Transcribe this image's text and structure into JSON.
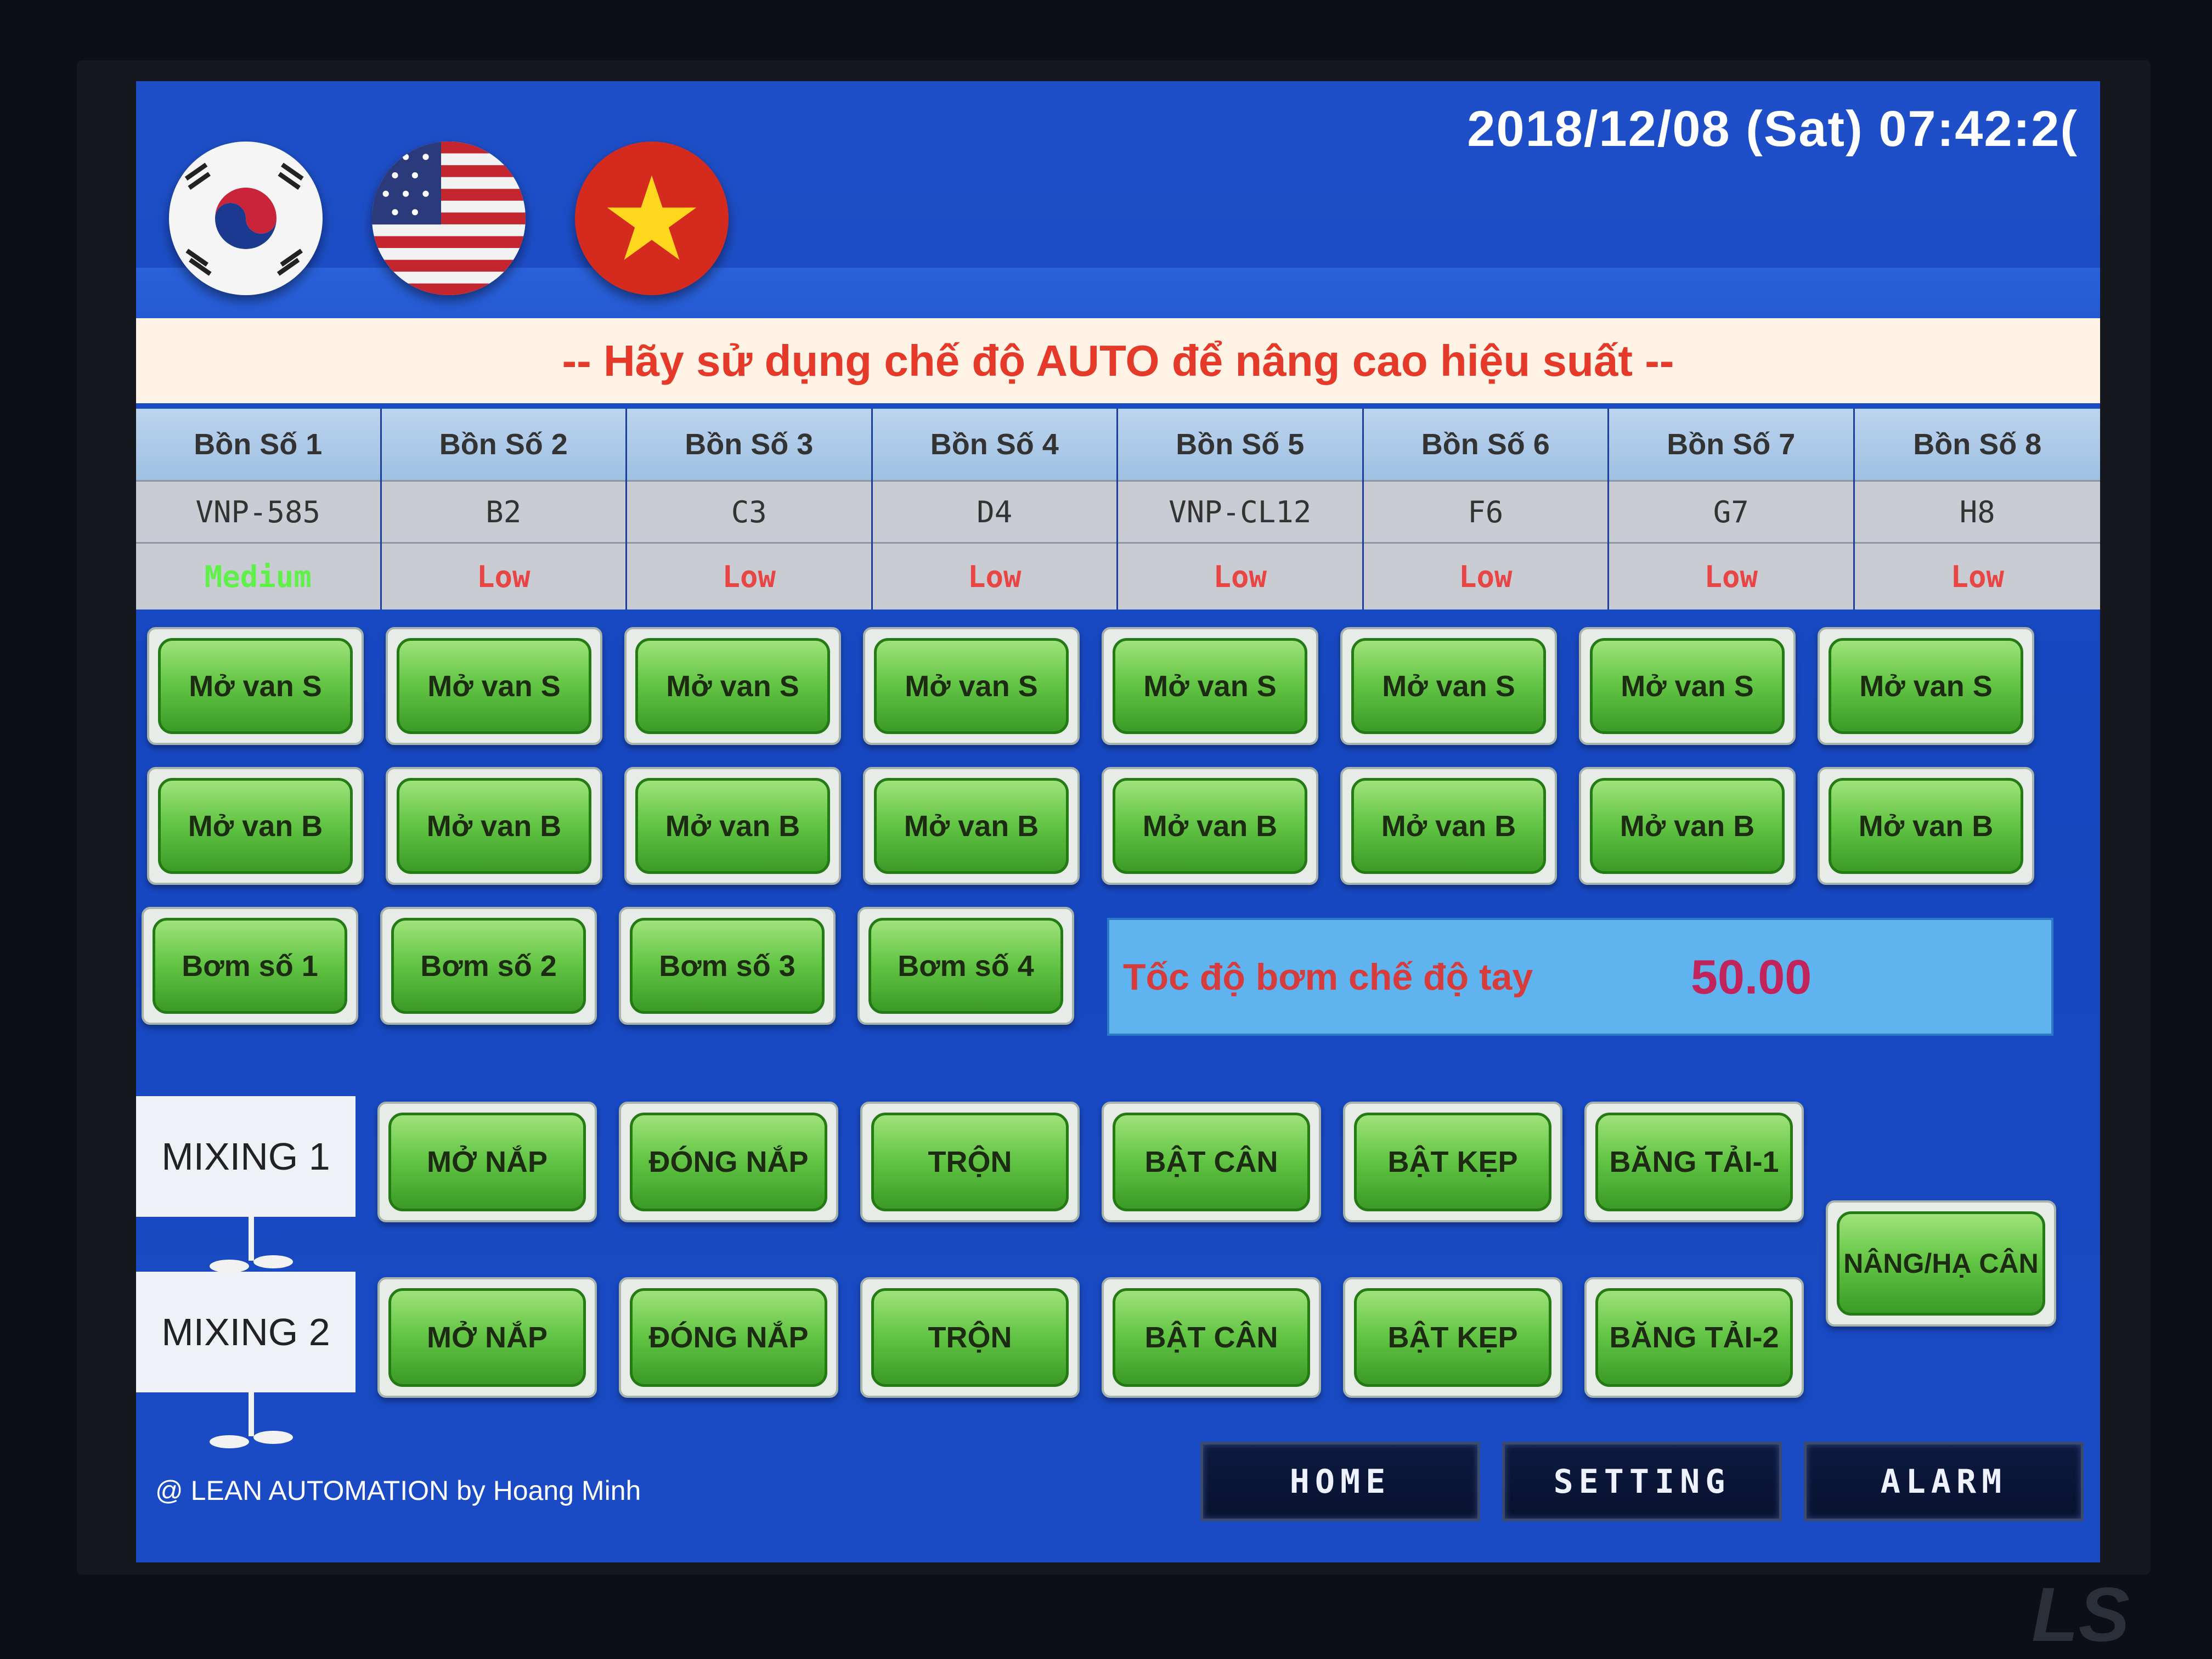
{
  "header": {
    "flags": [
      "korea-flag",
      "usa-flag",
      "vietnam-flag"
    ],
    "datetime": "2018/12/08 (Sat) 07:42:2("
  },
  "banner": {
    "text": "--  Hãy sử dụng chế độ AUTO để nâng cao hiệu suất  --"
  },
  "tanks": [
    {
      "name": "Bồn Số 1",
      "code": "VNP-585",
      "level": "Medium",
      "level_color": "#5ff04a"
    },
    {
      "name": "Bồn Số 2",
      "code": "B2",
      "level": "Low",
      "level_color": "#e84545"
    },
    {
      "name": "Bồn Số 3",
      "code": "C3",
      "level": "Low",
      "level_color": "#e84545"
    },
    {
      "name": "Bồn Số 4",
      "code": "D4",
      "level": "Low",
      "level_color": "#e84545"
    },
    {
      "name": "Bồn Số 5",
      "code": "VNP-CL12",
      "level": "Low",
      "level_color": "#e84545"
    },
    {
      "name": "Bồn Số 6",
      "code": "F6",
      "level": "Low",
      "level_color": "#e84545"
    },
    {
      "name": "Bồn Số 7",
      "code": "G7",
      "level": "Low",
      "level_color": "#e84545"
    },
    {
      "name": "Bồn Số 8",
      "code": "H8",
      "level": "Low",
      "level_color": "#e84545"
    }
  ],
  "valve_s_label": "Mở van S",
  "valve_b_label": "Mở van B",
  "pumps": [
    "Bơm số 1",
    "Bơm số 2",
    "Bơm số 3",
    "Bơm số 4"
  ],
  "manual_speed": {
    "label": "Tốc độ bơm chế độ tay",
    "value": "50.00"
  },
  "mixing1": {
    "label": "MIXING 1",
    "buttons": [
      "MỞ NẮP",
      "ĐÓNG NẮP",
      "TRỘN",
      "BẬT CÂN",
      "BẬT KẸP",
      "BĂNG TẢI-1"
    ]
  },
  "mixing2": {
    "label": "MIXING 2",
    "buttons": [
      "MỞ NẮP",
      "ĐÓNG NẮP",
      "TRỘN",
      "BẬT CÂN",
      "BẬT KẸP",
      "BĂNG TẢI-2"
    ]
  },
  "lift_button": "NÂNG/HẠ CÂN",
  "nav": {
    "home": "HOME",
    "setting": "SETTING",
    "alarm": "ALARM"
  },
  "footer": "@ LEAN AUTOMATION by Hoang Minh",
  "device_logo": "LS",
  "colors": {
    "screen_bg": "#1a4bc4",
    "button_green": "#62c544",
    "banner_text": "#e53a2a",
    "speed_value": "#c0245a"
  }
}
